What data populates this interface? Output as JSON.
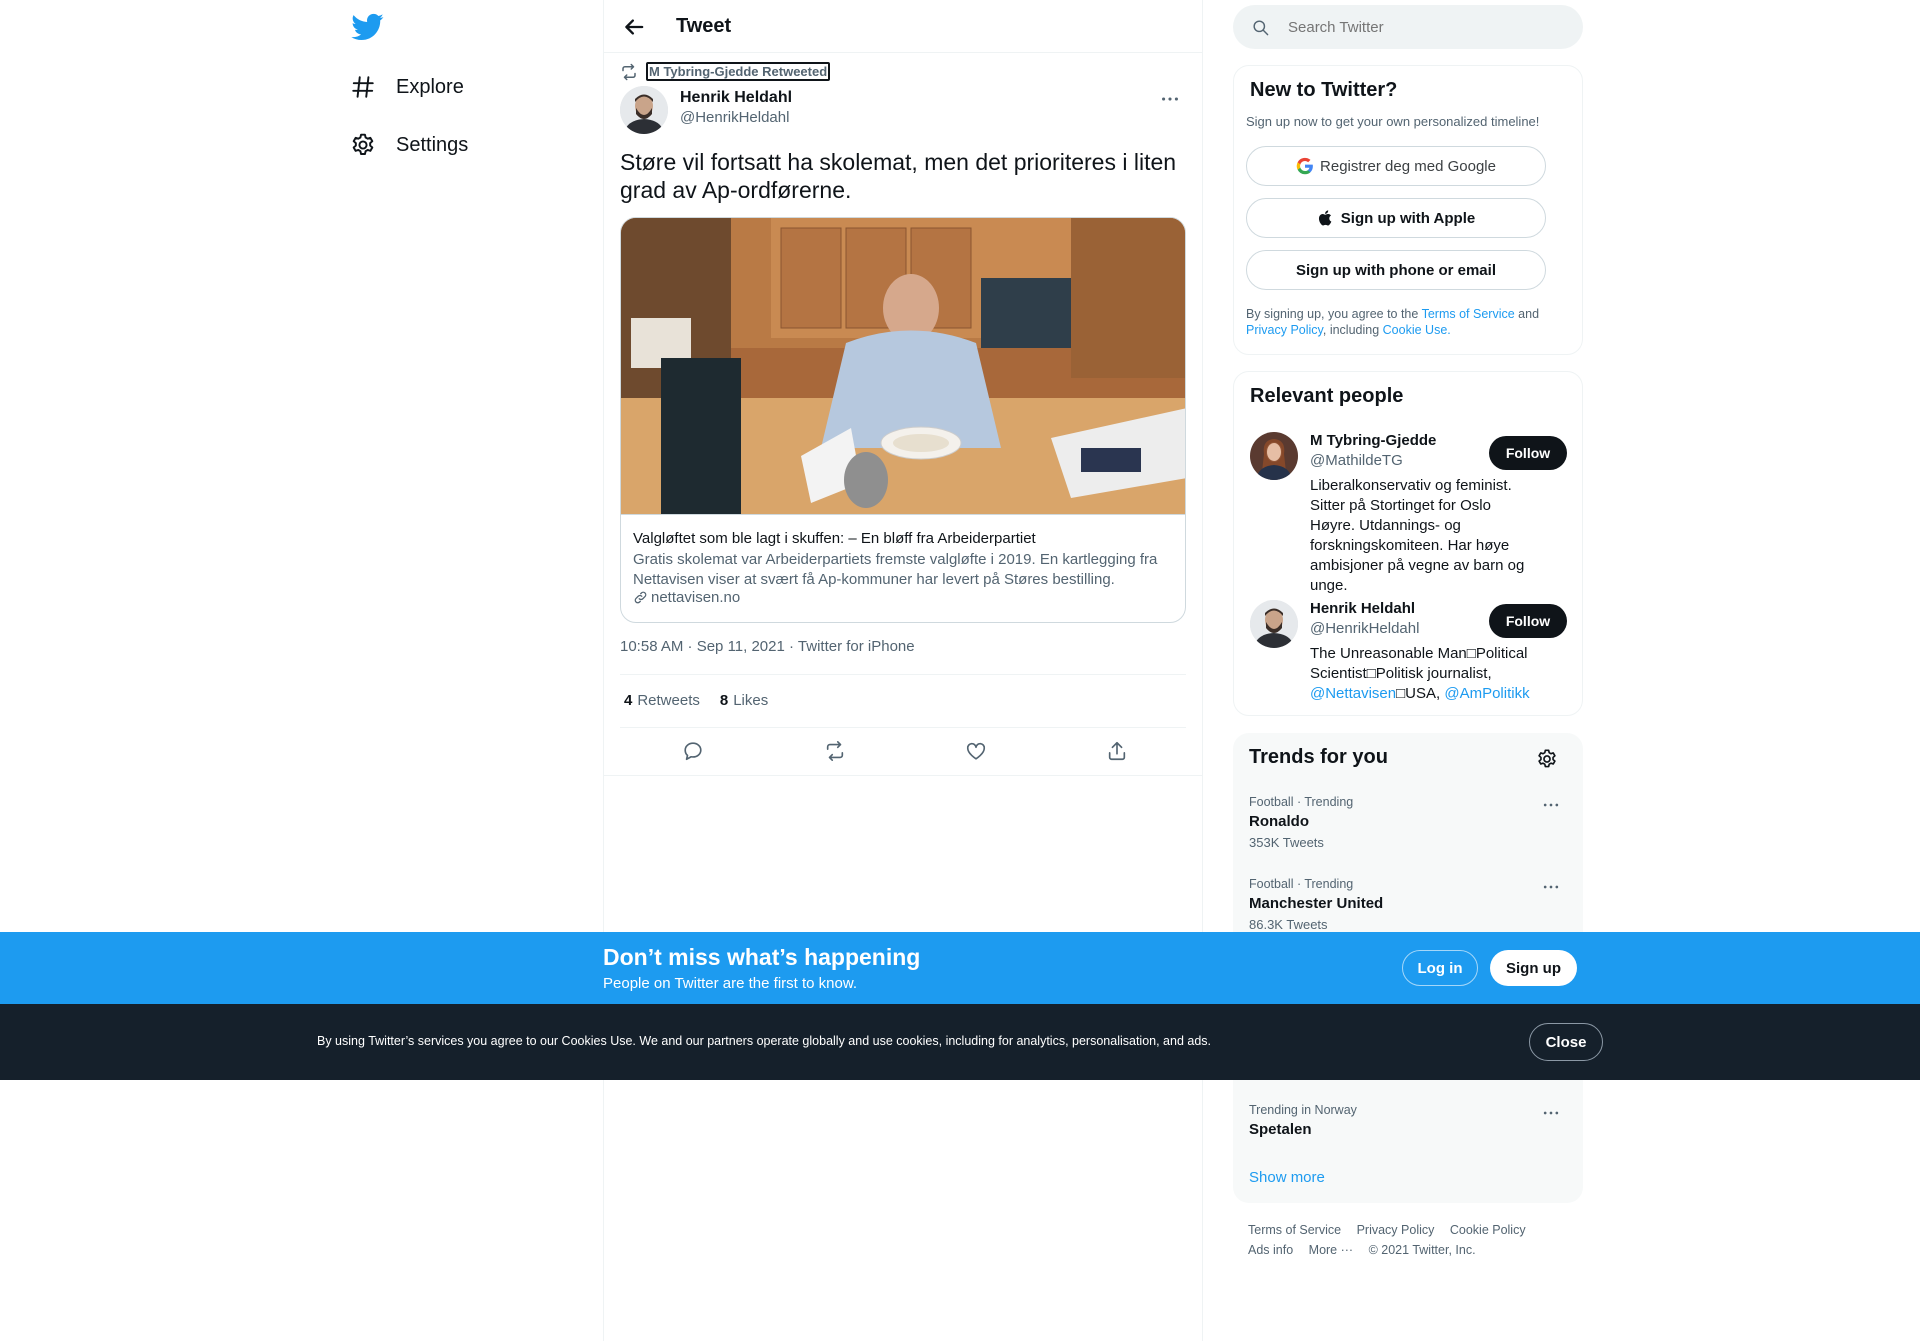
{
  "nav": {
    "explore_label": "Explore",
    "settings_label": "Settings"
  },
  "header": {
    "title": "Tweet"
  },
  "tweet": {
    "retweeted_by": "M Tybring-Gjedde Retweeted",
    "author_name": "Henrik Heldahl",
    "author_handle": "@HenrikHeldahl",
    "text": "Støre vil fortsatt ha skolemat, men det prioriteres i liten grad av Ap-ordførerne.",
    "card": {
      "title": "Valgløftet som ble lagt i skuffen: – En bløff fra Arbeiderpartiet",
      "description": "Gratis skolemat var Arbeiderpartiets fremste valgløfte i 2019. En kartlegging fra Nettavisen viser at svært få Ap-kommuner har levert på Støres bestilling.",
      "domain": "nettavisen.no"
    },
    "timestamp": "10:58 AM · Sep 11, 2021 · Twitter for iPhone",
    "retweets_count": "4",
    "retweets_label": "Retweets",
    "likes_count": "8",
    "likes_label": "Likes"
  },
  "search": {
    "placeholder": "Search Twitter"
  },
  "new_to_twitter": {
    "heading": "New to Twitter?",
    "subtext": "Sign up now to get your own personalized timeline!",
    "google_label": "Registrer deg med Google",
    "apple_label": "Sign up with Apple",
    "phone_label": "Sign up with phone or email",
    "legal_prefix": "By signing up, you agree to the",
    "tos": "Terms of Service",
    "and": "and",
    "privacy": "Privacy Policy",
    "including": ", including",
    "cookie_use": "Cookie Use."
  },
  "relevant_people": {
    "heading": "Relevant people",
    "people": [
      {
        "name": "M Tybring-Gjedde",
        "handle": "@MathildeTG",
        "bio": "Liberalkonservativ og feminist. Sitter på Stortinget for Oslo Høyre. Utdannings- og forskningskomiteen. Har høye ambisjoner på vegne av barn og unge.",
        "follow_label": "Follow"
      },
      {
        "name": "Henrik Heldahl",
        "handle": "@HenrikHeldahl",
        "bio_part1": "The Unreasonable Man□Political Scientist□Politisk journalist,",
        "bio_link1": "@Nettavisen",
        "bio_part2": "□USA,",
        "bio_link2": "@AmPolitikk",
        "follow_label": "Follow"
      }
    ]
  },
  "trends": {
    "heading": "Trends for you",
    "items": [
      {
        "meta": "Football · Trending",
        "name": "Ronaldo",
        "count": "353K Tweets"
      },
      {
        "meta": "Football · Trending",
        "name": "Manchester United",
        "count": "86.3K Tweets"
      },
      {
        "meta": "Trending in Norway",
        "name": "Spetalen",
        "count": ""
      }
    ],
    "show_more": "Show more"
  },
  "footer": {
    "links": [
      "Terms of Service",
      "Privacy Policy",
      "Cookie Policy"
    ],
    "ads_info": "Ads info",
    "more": "More ···",
    "copyright": "© 2021 Twitter, Inc."
  },
  "banner": {
    "title": "Don’t miss what’s happening",
    "subtitle": "People on Twitter are the first to know.",
    "login_label": "Log in",
    "signup_label": "Sign up"
  },
  "cookie_banner": {
    "text": "By using Twitter’s services you agree to our Cookies Use. We and our partners operate globally and use cookies, including for analytics, personalisation, and ads.",
    "close_label": "Close"
  },
  "colors": {
    "accent": "#1d9bf0",
    "text_primary": "#0f1419",
    "text_secondary": "#536471",
    "cookie_bg": "#15202b"
  }
}
